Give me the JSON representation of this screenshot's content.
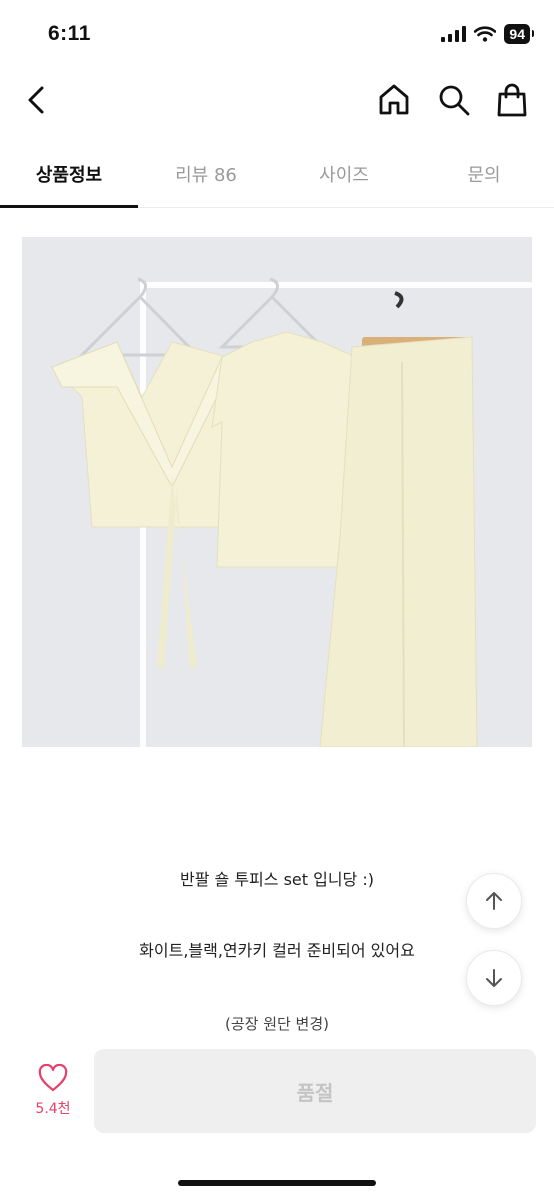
{
  "status_bar": {
    "time": "6:11",
    "battery": "94"
  },
  "header": {
    "back_icon": "chevron-left-icon",
    "home_icon": "home-icon",
    "search_icon": "search-icon",
    "cart_icon": "shopping-bag-icon"
  },
  "tabs": [
    {
      "label": "상품정보",
      "active": true
    },
    {
      "label": "리뷰 86",
      "active": false
    },
    {
      "label": "사이즈",
      "active": false
    },
    {
      "label": "문의",
      "active": false
    }
  ],
  "description": {
    "line1": "반팔 숄 투피스 set 입니당 :)",
    "line2": "화이트,블랙,연카키 컬러 준비되어 있어요",
    "line3": "(공장 원단 변경)"
  },
  "floating": {
    "up_icon": "arrow-up-icon",
    "down_icon": "arrow-down-icon"
  },
  "bottom_bar": {
    "like_icon": "heart-icon",
    "like_count": "5.4천",
    "buy_label": "품절"
  },
  "colors": {
    "accent_pink": "#e8406c",
    "disabled_bg": "#efefef",
    "disabled_text": "#c4c4c4",
    "garment": "#f4f1d6"
  }
}
